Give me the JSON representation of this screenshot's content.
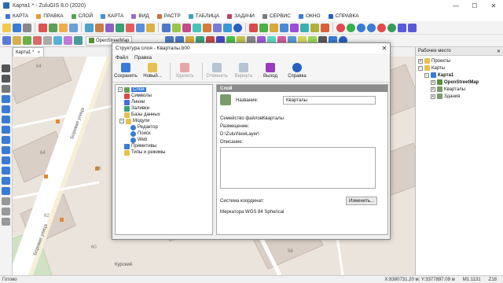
{
  "app": {
    "title": "Карта1 * - ZuluGIS 8.0 (2020)",
    "min_glyph": "—",
    "max_glyph": "☐",
    "close_glyph": "✕"
  },
  "menu": [
    "КАРТА",
    "ПРАВКА",
    "СЛОЙ",
    "КАРТА",
    "ВИД",
    "РАСТР",
    "ТАБЛИЦА",
    "ЗАДАЧИ",
    "СЕРВИС",
    "ОКНО",
    "СПРАВКА"
  ],
  "toolbar": {
    "osm_label": "OpenStreetMap"
  },
  "map_tab": {
    "label": "Карта1 *",
    "close_glyph": "✕"
  },
  "map": {
    "street_1": "Боровая улица",
    "street_2": "Боровая улица",
    "street_3": "Курский",
    "numbers": [
      "64",
      "64",
      "66",
      "62",
      "60",
      "62",
      "64",
      "58",
      "56"
    ]
  },
  "workspace": {
    "title": "Рабочее место",
    "pin_glyph": "✕",
    "tree": {
      "projects": "Проекты",
      "maps": "Карты",
      "map1": "Карта1",
      "osm": "OpenStreetMap",
      "quarters": "Кварталы",
      "buildings": "Здания"
    }
  },
  "status": {
    "left": "Готово",
    "coords": "X:8380731.20 м; Y:3377897.09 м",
    "scale": "M1:1131",
    "zoom": "Z18"
  },
  "dialog": {
    "title": "Структура слоя - Кварталы.b00",
    "close_glyph": "✕",
    "menu": [
      "Файл",
      "Правка"
    ],
    "tools": {
      "save": "Сохранить",
      "new": "Новый...",
      "delete": "Удалить",
      "undo": "Отменить",
      "redo": "Вернуть",
      "exit": "Выход",
      "help": "Справка"
    },
    "tree": {
      "layer": "Слой",
      "symbols": "Символы",
      "lines": "Линии",
      "fills": "Заливки",
      "databases": "Базы данных",
      "modules": "Модули",
      "editor": "Редактор",
      "search": "Поиск",
      "web": "Web",
      "primitives": "Примитивы",
      "types": "Типы и режимы"
    },
    "section_title": "Слой",
    "name_label": "Название:",
    "name_value": "Кварталы",
    "family_label": "Семейство файлов:",
    "family_value": "Кварталы",
    "location_label": "Размещение:",
    "location_value": "D:\\Zulu\\NewLayer\\",
    "description_label": "Описание:",
    "description_value": "",
    "crs_label": "Система координат:",
    "crs_value": "Меркатора WGS 84 Spherical",
    "change_button": "Изменить..."
  }
}
